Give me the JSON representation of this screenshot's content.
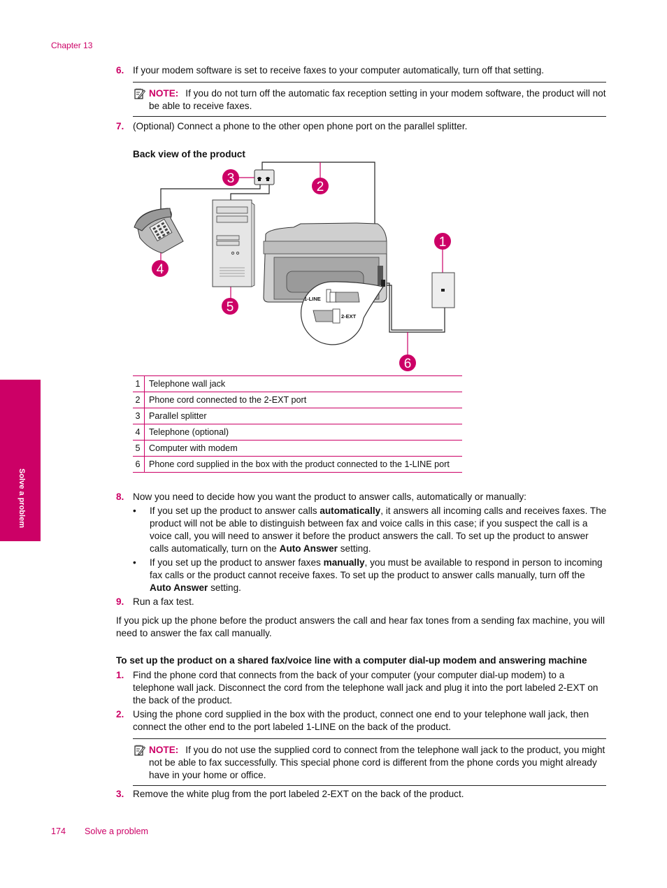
{
  "header": {
    "chapter": "Chapter 13"
  },
  "steps_top": [
    {
      "num": "6.",
      "text": "If your modem software is set to receive faxes to your computer automatically, turn off that setting."
    },
    {
      "num": "7.",
      "text": "(Optional) Connect a phone to the other open phone port on the parallel splitter."
    }
  ],
  "note1": {
    "label": "NOTE:",
    "text": "If you do not turn off the automatic fax reception setting in your modem software, the product will not be able to receive faxes."
  },
  "figure": {
    "title": "Back view of the product",
    "callouts": [
      "1",
      "2",
      "3",
      "4",
      "5",
      "6"
    ],
    "port_labels": {
      "line": "1-LINE",
      "ext": "2-EXT"
    }
  },
  "legend": [
    {
      "num": "1",
      "text": "Telephone wall jack"
    },
    {
      "num": "2",
      "text": "Phone cord connected to the 2-EXT port"
    },
    {
      "num": "3",
      "text": "Parallel splitter"
    },
    {
      "num": "4",
      "text": "Telephone (optional)"
    },
    {
      "num": "5",
      "text": "Computer with modem"
    },
    {
      "num": "6",
      "text": "Phone cord supplied in the box with the product connected to the 1-LINE port"
    }
  ],
  "step8": {
    "num": "8.",
    "text": "Now you need to decide how you want the product to answer calls, automatically or manually:",
    "bullets": [
      {
        "pre": "If you set up the product to answer calls ",
        "bold": "automatically",
        "mid": ", it answers all incoming calls and receives faxes. The product will not be able to distinguish between fax and voice calls in this case; if you suspect the call is a voice call, you will need to answer it before the product answers the call. To set up the product to answer calls automatically, turn on the ",
        "bold2": "Auto Answer",
        "post": " setting."
      },
      {
        "pre": "If you set up the product to answer faxes ",
        "bold": "manually",
        "mid": ", you must be available to respond in person to incoming fax calls or the product cannot receive faxes. To set up the product to answer calls manually, turn off the ",
        "bold2": "Auto Answer",
        "post": " setting."
      }
    ],
    "bullet_char": "•"
  },
  "step9": {
    "num": "9.",
    "text": "Run a fax test."
  },
  "para1": "If you pick up the phone before the product answers the call and hear fax tones from a sending fax machine, you will need to answer the fax call manually.",
  "section2": {
    "heading": "To set up the product on a shared fax/voice line with a computer dial-up modem and answering machine",
    "steps": [
      {
        "num": "1.",
        "text": "Find the phone cord that connects from the back of your computer (your computer dial-up modem) to a telephone wall jack. Disconnect the cord from the telephone wall jack and plug it into the port labeled 2-EXT on the back of the product."
      },
      {
        "num": "2.",
        "text": "Using the phone cord supplied in the box with the product, connect one end to your telephone wall jack, then connect the other end to the port labeled 1-LINE on the back of the product."
      },
      {
        "num": "3.",
        "text": "Remove the white plug from the port labeled 2-EXT on the back of the product."
      }
    ],
    "note": {
      "label": "NOTE:",
      "text": "If you do not use the supplied cord to connect from the telephone wall jack to the product, you might not be able to fax successfully. This special phone cord is different from the phone cords you might already have in your home or office."
    }
  },
  "side_tab": "Solve a problem",
  "footer": {
    "page": "174",
    "title": "Solve a problem"
  },
  "colors": {
    "accent": "#cc0066"
  }
}
